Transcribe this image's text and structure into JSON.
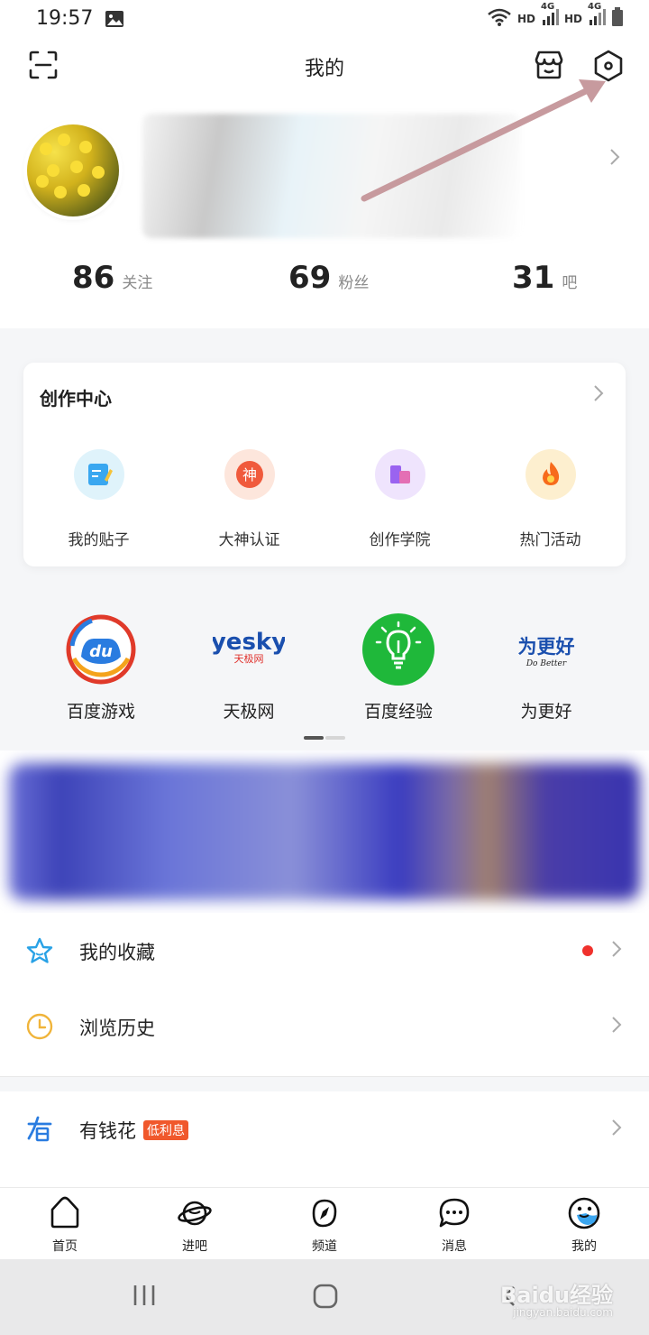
{
  "status_bar": {
    "time": "19:57",
    "network1": "HD",
    "net1_type": "4G",
    "network2": "HD",
    "net2_type": "4G"
  },
  "header": {
    "title": "我的"
  },
  "profile": {
    "stats": [
      {
        "value": "86",
        "label": "关注"
      },
      {
        "value": "69",
        "label": "粉丝"
      },
      {
        "value": "31",
        "label": "吧"
      }
    ]
  },
  "creation_center": {
    "title": "创作中心",
    "items": [
      {
        "label": "我的贴子",
        "icon": "edit-post-icon",
        "color": "#39a7f0"
      },
      {
        "label": "大神认证",
        "icon": "shen-badge-icon",
        "color": "#f05a3c"
      },
      {
        "label": "创作学院",
        "icon": "academy-icon",
        "color": "#9a63f0"
      },
      {
        "label": "热门活动",
        "icon": "fire-icon",
        "color": "#f76b1c"
      }
    ]
  },
  "services": {
    "items": [
      {
        "label": "百度游戏",
        "logo_text": "du"
      },
      {
        "label": "天极网",
        "logo_text": "yesky",
        "logo_subtext": "天极网"
      },
      {
        "label": "百度经验",
        "logo_text": ""
      },
      {
        "label": "为更好",
        "logo_text": "为更好",
        "logo_subtext": "Do Better"
      }
    ]
  },
  "menu": {
    "favorites": "我的收藏",
    "history": "浏览历史",
    "youqianhua": "有钱花",
    "youqianhua_badge": "低利息"
  },
  "tabbar": {
    "items": [
      {
        "label": "首页"
      },
      {
        "label": "进吧"
      },
      {
        "label": "频道"
      },
      {
        "label": "消息"
      },
      {
        "label": "我的"
      }
    ]
  },
  "watermark": {
    "brand": "Baidu经验",
    "url": "jingyan.baidu.com"
  },
  "colors": {
    "accent_blue": "#2a7ce0",
    "red_dot": "#f0312c",
    "arrow": "#c79a9e"
  }
}
